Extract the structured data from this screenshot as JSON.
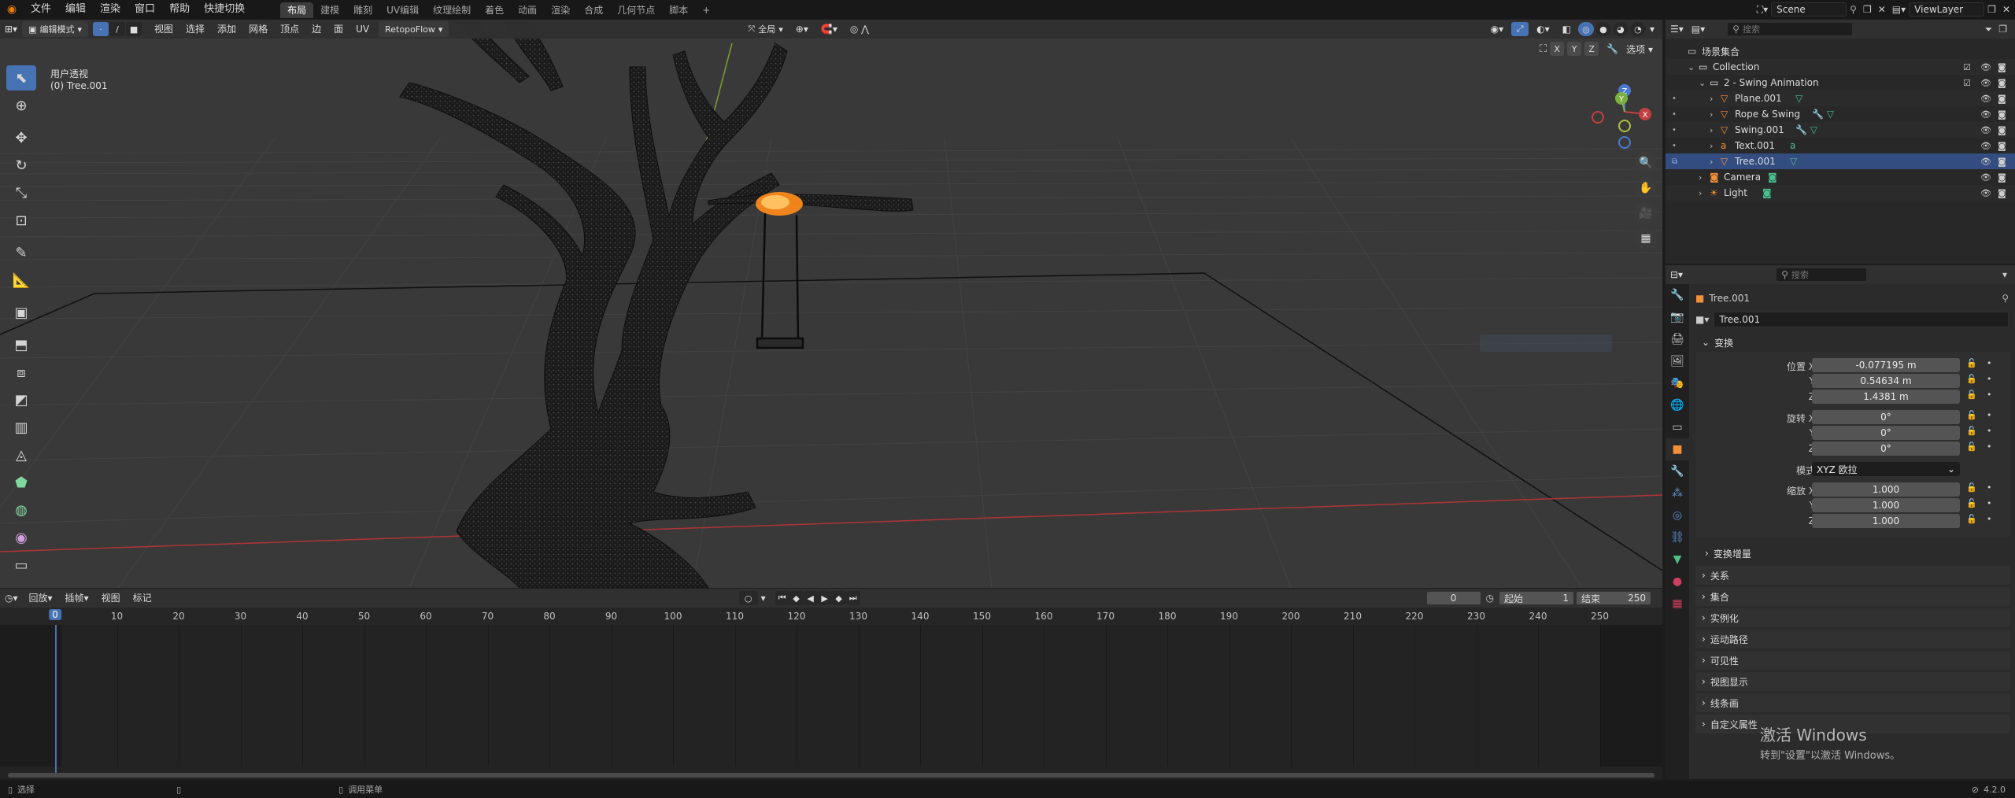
{
  "topbar": {
    "menus": [
      "文件",
      "编辑",
      "渲染",
      "窗口",
      "帮助",
      "快捷切换"
    ],
    "workspaces": [
      "布局",
      "建模",
      "雕刻",
      "UV编辑",
      "纹理绘制",
      "着色",
      "动画",
      "渲染",
      "合成",
      "几何节点",
      "脚本"
    ],
    "add_tab": "+",
    "scene": "Scene",
    "view_layer": "ViewLayer"
  },
  "viewport": {
    "mode": "编辑模式",
    "menus": [
      "视图",
      "选择",
      "添加",
      "网格",
      "顶点",
      "边",
      "面",
      "UV"
    ],
    "addon": "RetopoFlow",
    "transform_orientation": "全局",
    "axes": [
      "X",
      "Y",
      "Z"
    ],
    "options": "选项",
    "view_name": "用户透视",
    "object_label": "(0) Tree.001"
  },
  "timeline": {
    "menus": [
      "回放",
      "插帧",
      "视图",
      "标记"
    ],
    "current_frame": "0",
    "start_label": "起始",
    "start": "1",
    "end_label": "结束",
    "end": "250",
    "ticks": [
      0,
      10,
      20,
      30,
      40,
      50,
      60,
      70,
      80,
      90,
      100,
      110,
      120,
      130,
      140,
      150,
      160,
      170,
      180,
      190,
      200,
      210,
      220,
      230,
      240,
      250
    ]
  },
  "outliner": {
    "search_placeholder": "搜索",
    "rows": [
      {
        "label": "场景集合",
        "type": "scene"
      },
      {
        "label": "Collection",
        "type": "collection"
      },
      {
        "label": "2 - Swing Animation",
        "type": "collection"
      },
      {
        "label": "Plane.001",
        "type": "mesh"
      },
      {
        "label": "Rope & Swing",
        "type": "mesh"
      },
      {
        "label": "Swing.001",
        "type": "mesh"
      },
      {
        "label": "Text.001",
        "type": "text"
      },
      {
        "label": "Tree.001",
        "type": "mesh"
      },
      {
        "label": "Camera",
        "type": "camera"
      },
      {
        "label": "Light",
        "type": "light"
      }
    ]
  },
  "properties": {
    "search_placeholder": "搜索",
    "object_name": "Tree.001",
    "object_field": "Tree.001",
    "transform_title": "变换",
    "location_label": "位置 X",
    "loc_x": "-0.077195 m",
    "loc_y": "0.54634 m",
    "loc_z": "1.4381 m",
    "rotation_label": "旋转 X",
    "rot_x": "0°",
    "rot_y": "0°",
    "rot_z": "0°",
    "mode_label": "模式",
    "mode_value": "XYZ 欧拉",
    "scale_label": "缩放 X",
    "scale_x": "1.000",
    "scale_y": "1.000",
    "scale_z": "1.000",
    "axis_y": "Y",
    "axis_z": "Z",
    "delta_transform": "变换增量",
    "panels": [
      "关系",
      "集合",
      "实例化",
      "运动路径",
      "可见性",
      "视图显示",
      "线条画",
      "自定义属性"
    ]
  },
  "watermark": {
    "line1": "激活 Windows",
    "line2": "转到\"设置\"以激活 Windows。"
  },
  "statusbar": {
    "select": "选择",
    "context_menu": "调用菜单",
    "version": "4.2.0"
  },
  "colors": {
    "accent": "#4772b3",
    "selected_row": "#334d80",
    "selection_orange": "#ff8c1a",
    "axis_red": "#b03434",
    "axis_green": "#7aa030"
  }
}
